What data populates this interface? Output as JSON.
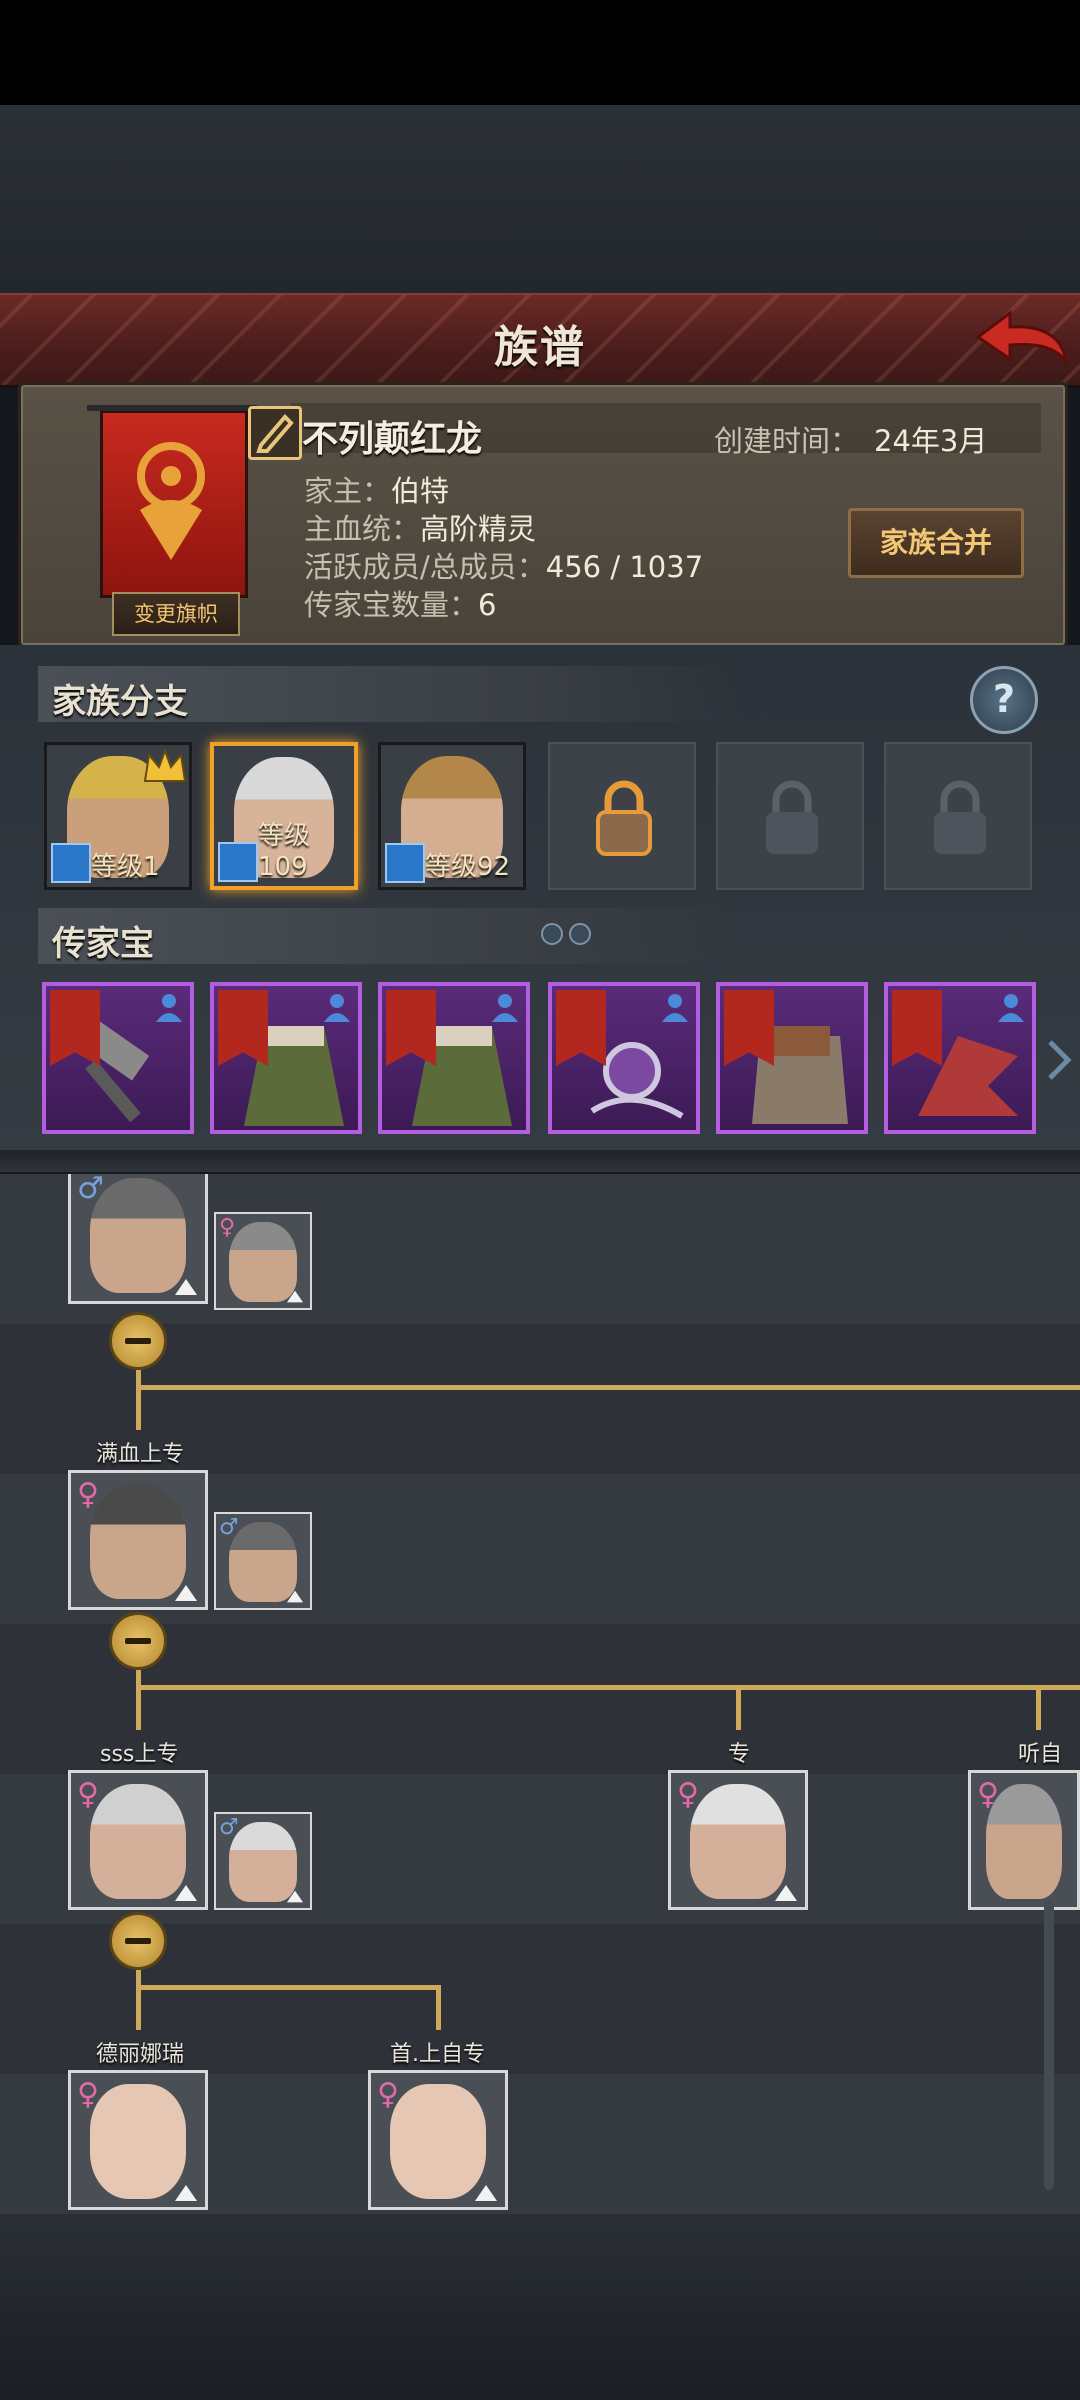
{
  "header": {
    "title": "族谱"
  },
  "clan": {
    "name": "不列颠红龙",
    "created_label": "创建时间：",
    "created_value": "24年3月",
    "leader_label": "家主：",
    "leader_value": "伯特",
    "bloodline_label": "主血统：",
    "bloodline_value": "高阶精灵",
    "members_label": "活跃成员/总成员：",
    "members_value": "456 / 1037",
    "heirlooms_label": "传家宝数量：",
    "heirlooms_value": "6",
    "change_banner_label": "变更旗帜",
    "merge_label": "家族合并",
    "banner_color": "#c82a1f"
  },
  "branches": {
    "title": "家族分支",
    "help_glyph": "?",
    "items": [
      {
        "level_label": "等级1",
        "hair": "#d6b24a",
        "selected": false,
        "crown": true
      },
      {
        "level_label": "等级109",
        "hair": "#d9d9d9",
        "selected": true,
        "crown": false
      },
      {
        "level_label": "等级92",
        "hair": "#b3874a",
        "selected": false,
        "crown": false
      }
    ],
    "locked_slots": 3
  },
  "heirlooms": {
    "title": "传家宝",
    "items": [
      {
        "icon": "hammer-icon",
        "color": "#8a8a8a"
      },
      {
        "icon": "cloak-icon",
        "color": "#5c6b3a"
      },
      {
        "icon": "cloak-icon",
        "color": "#5c6b3a"
      },
      {
        "icon": "orb-icon",
        "color": "#7b4aa0"
      },
      {
        "icon": "armor-icon",
        "color": "#8a5a3a"
      },
      {
        "icon": "dragon-icon",
        "color": "#b03a3a"
      }
    ]
  },
  "tree": {
    "labels": {
      "gen2": "满血上专",
      "gen3a": "sss上专",
      "gen3b": "专",
      "gen3c": "听自",
      "gen4a": "德丽娜瑞",
      "gen4b": "首.上自专"
    },
    "gender_male": "♂",
    "gender_female": "♀"
  }
}
